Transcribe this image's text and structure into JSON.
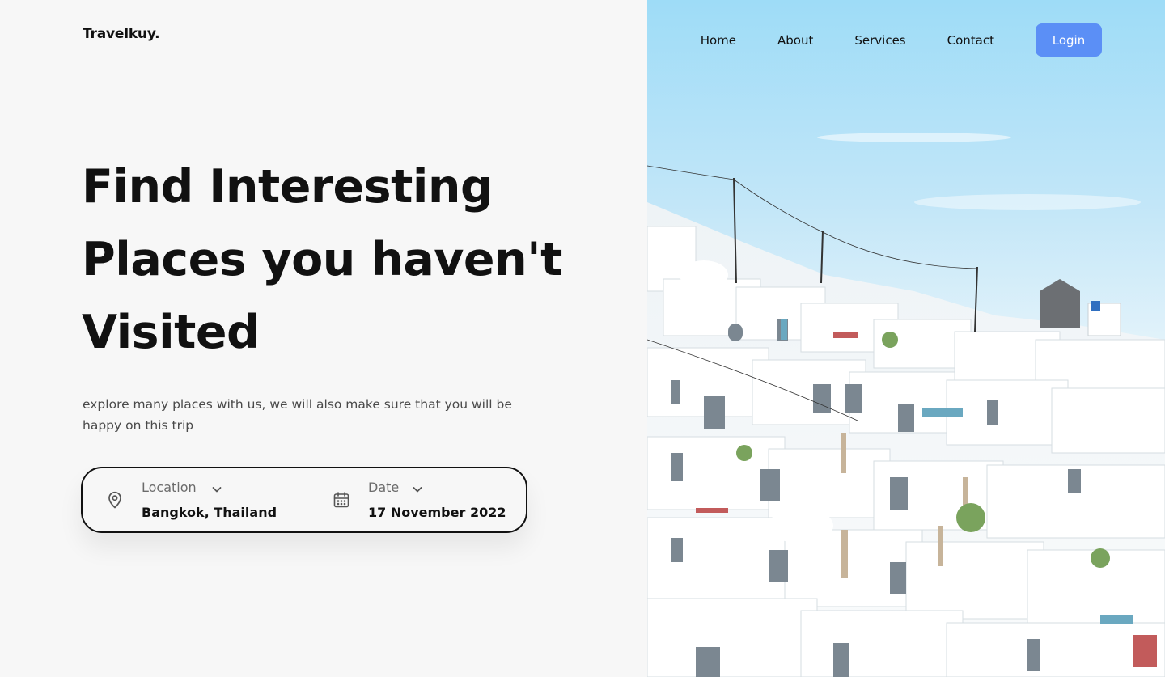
{
  "brand": {
    "name": "Travelkuy."
  },
  "nav": {
    "items": [
      "Home",
      "About",
      "Services",
      "Contact"
    ],
    "login_label": "Login"
  },
  "hero": {
    "title_lines": [
      "Find Interesting",
      "Places you haven't",
      "Visited"
    ],
    "subtitle": "explore many places with us, we will also make sure that you will be happy on this trip"
  },
  "search": {
    "location_label": "Location",
    "location_value": "Bangkok, Thailand",
    "date_label": "Date",
    "date_value": "17 November 2022"
  },
  "icons": {
    "location": "map-pin-icon",
    "date": "calendar-icon",
    "dropdown": "chevron-down-icon"
  },
  "colors": {
    "accent": "#5b8ff6",
    "background": "#f7f7f7",
    "text": "#111111",
    "muted": "#4a4a4a"
  }
}
